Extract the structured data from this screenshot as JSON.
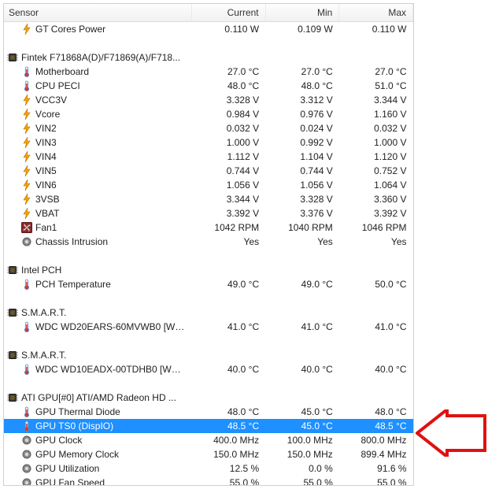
{
  "columns": {
    "sensor": "Sensor",
    "current": "Current",
    "min": "Min",
    "max": "Max"
  },
  "rows": [
    {
      "type": "item",
      "icon": "bolt",
      "name": "GT Cores Power",
      "current": "0.110 W",
      "min": "0.109 W",
      "max": "0.110 W"
    },
    {
      "type": "spacer"
    },
    {
      "type": "group",
      "icon": "chip",
      "name": "Fintek F71868A(D)/F71869(A)/F718..."
    },
    {
      "type": "item",
      "icon": "thermo",
      "name": "Motherboard",
      "current": "27.0 °C",
      "min": "27.0 °C",
      "max": "27.0 °C"
    },
    {
      "type": "item",
      "icon": "thermo",
      "name": "CPU PECI",
      "current": "48.0 °C",
      "min": "48.0 °C",
      "max": "51.0 °C"
    },
    {
      "type": "item",
      "icon": "bolt",
      "name": "VCC3V",
      "current": "3.328 V",
      "min": "3.312 V",
      "max": "3.344 V"
    },
    {
      "type": "item",
      "icon": "bolt",
      "name": "Vcore",
      "current": "0.984 V",
      "min": "0.976 V",
      "max": "1.160 V"
    },
    {
      "type": "item",
      "icon": "bolt",
      "name": "VIN2",
      "current": "0.032 V",
      "min": "0.024 V",
      "max": "0.032 V"
    },
    {
      "type": "item",
      "icon": "bolt",
      "name": "VIN3",
      "current": "1.000 V",
      "min": "0.992 V",
      "max": "1.000 V"
    },
    {
      "type": "item",
      "icon": "bolt",
      "name": "VIN4",
      "current": "1.112 V",
      "min": "1.104 V",
      "max": "1.120 V"
    },
    {
      "type": "item",
      "icon": "bolt",
      "name": "VIN5",
      "current": "0.744 V",
      "min": "0.744 V",
      "max": "0.752 V"
    },
    {
      "type": "item",
      "icon": "bolt",
      "name": "VIN6",
      "current": "1.056 V",
      "min": "1.056 V",
      "max": "1.064 V"
    },
    {
      "type": "item",
      "icon": "bolt",
      "name": "3VSB",
      "current": "3.344 V",
      "min": "3.328 V",
      "max": "3.360 V"
    },
    {
      "type": "item",
      "icon": "bolt",
      "name": "VBAT",
      "current": "3.392 V",
      "min": "3.376 V",
      "max": "3.392 V"
    },
    {
      "type": "item",
      "icon": "fan",
      "name": "Fan1",
      "current": "1042 RPM",
      "min": "1040 RPM",
      "max": "1046 RPM"
    },
    {
      "type": "item",
      "icon": "dot",
      "name": "Chassis Intrusion",
      "current": "Yes",
      "min": "Yes",
      "max": "Yes"
    },
    {
      "type": "spacer"
    },
    {
      "type": "group",
      "icon": "chip",
      "name": "Intel PCH"
    },
    {
      "type": "item",
      "icon": "thermo",
      "name": "PCH Temperature",
      "current": "49.0 °C",
      "min": "49.0 °C",
      "max": "50.0 °C"
    },
    {
      "type": "spacer"
    },
    {
      "type": "group",
      "icon": "chip",
      "name": "S.M.A.R.T."
    },
    {
      "type": "item",
      "icon": "thermo",
      "name": "WDC WD20EARS-60MVWB0 [WD-W...",
      "current": "41.0 °C",
      "min": "41.0 °C",
      "max": "41.0 °C"
    },
    {
      "type": "spacer"
    },
    {
      "type": "group",
      "icon": "chip",
      "name": "S.M.A.R.T."
    },
    {
      "type": "item",
      "icon": "thermo",
      "name": "WDC WD10EADX-00TDHB0 [WD-W...",
      "current": "40.0 °C",
      "min": "40.0 °C",
      "max": "40.0 °C"
    },
    {
      "type": "spacer"
    },
    {
      "type": "group",
      "icon": "chip",
      "name": "ATI GPU[#0] ATI/AMD Radeon HD ..."
    },
    {
      "type": "item",
      "icon": "thermo",
      "name": "GPU Thermal Diode",
      "current": "48.0 °C",
      "min": "45.0 °C",
      "max": "48.0 °C"
    },
    {
      "type": "item",
      "selected": true,
      "icon": "thermo",
      "name": "GPU TS0 (DispIO)",
      "current": "48.5 °C",
      "min": "45.0 °C",
      "max": "48.5 °C"
    },
    {
      "type": "item",
      "icon": "dot",
      "name": "GPU Clock",
      "current": "400.0 MHz",
      "min": "100.0 MHz",
      "max": "800.0 MHz"
    },
    {
      "type": "item",
      "icon": "dot",
      "name": "GPU Memory Clock",
      "current": "150.0 MHz",
      "min": "150.0 MHz",
      "max": "899.4 MHz"
    },
    {
      "type": "item",
      "icon": "dot",
      "name": "GPU Utilization",
      "current": "12.5 %",
      "min": "0.0 %",
      "max": "91.6 %"
    },
    {
      "type": "item",
      "icon": "dot",
      "name": "GPU Fan Speed",
      "current": "55.0 %",
      "min": "55.0 %",
      "max": "55.0 %"
    }
  ],
  "annotation": {
    "arrow_color": "#e11111"
  }
}
